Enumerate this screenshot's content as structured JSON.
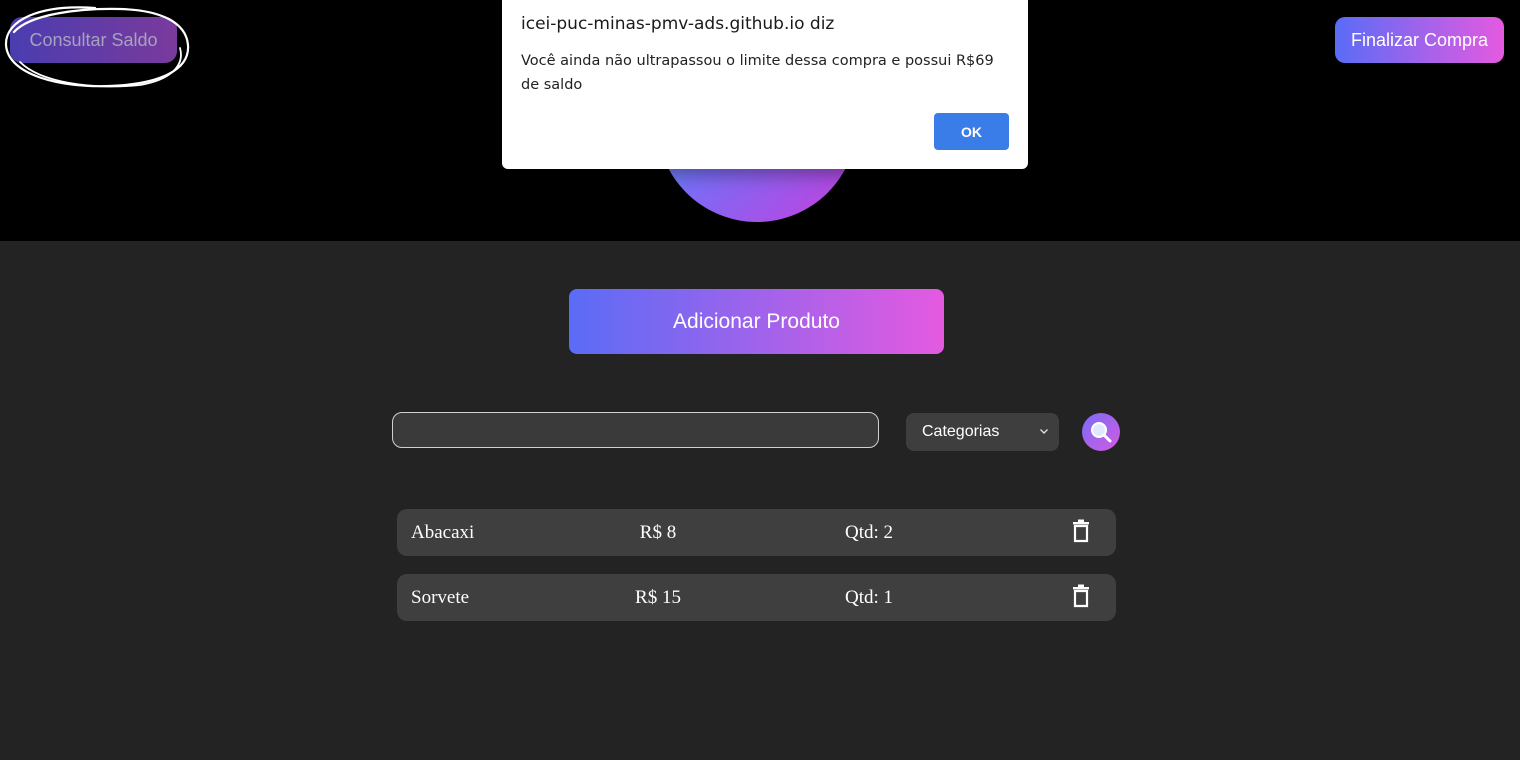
{
  "header": {
    "consultar_saldo_label": "Consultar Saldo",
    "finalizar_compra_label": "Finalizar Compra"
  },
  "dialog": {
    "title": "icei-puc-minas-pmv-ads.github.io diz",
    "message": "Você ainda não ultrapassou o limite dessa compra e possui R$69 de saldo",
    "ok_label": "OK"
  },
  "main": {
    "adicionar_produto_label": "Adicionar Produto",
    "search": {
      "value": "",
      "placeholder": ""
    },
    "category_select": {
      "selected": "Categorias"
    },
    "products": [
      {
        "name": "Abacaxi",
        "price": "R$ 8",
        "qty": "Qtd: 2"
      },
      {
        "name": "Sorvete",
        "price": "R$ 15",
        "qty": "Qtd: 1"
      }
    ]
  },
  "colors": {
    "header_bg": "#000000",
    "page_bg": "#232323",
    "gradient_start": "#5a6cf6",
    "gradient_end": "#e45ae0",
    "dialog_ok": "#3b7de8",
    "row_bg": "#3f3f3f"
  },
  "icons": [
    "search-icon",
    "trash-icon",
    "chevron-down-icon"
  ]
}
